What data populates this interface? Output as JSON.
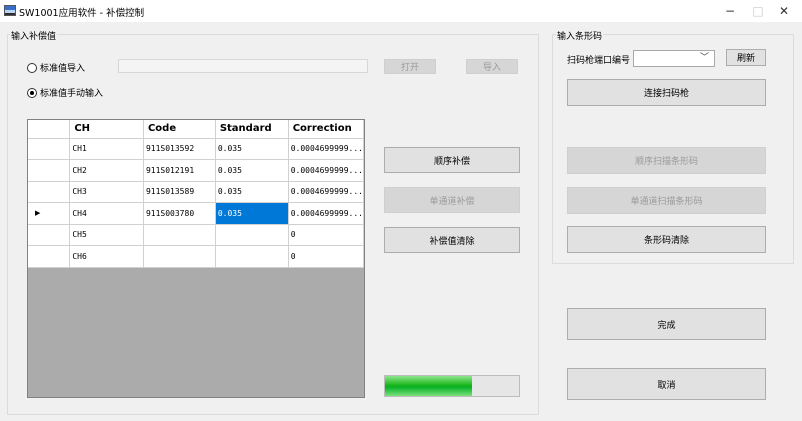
{
  "window": {
    "title": "SW1001应用软件 - 补偿控制",
    "minimize": "−",
    "maximize": "□",
    "close": "✕"
  },
  "input_group": {
    "title": "输入补偿值",
    "radio_import_label": "标准值导入",
    "radio_import_checked": false,
    "radio_manual_label": "标准值手动输入",
    "radio_manual_checked": true,
    "file_path_value": "",
    "open_label": "打开",
    "import_label": "导入"
  },
  "grid": {
    "columns": [
      "CH",
      "Code",
      "Standard",
      "Correction"
    ],
    "current_row_indicator": "▶",
    "rows": [
      {
        "ch": "CH1",
        "code": "911S013592",
        "standard": "0.035",
        "correction": "0.0004699999..."
      },
      {
        "ch": "CH2",
        "code": "911S012191",
        "standard": "0.035",
        "correction": "0.0004699999..."
      },
      {
        "ch": "CH3",
        "code": "911S013589",
        "standard": "0.035",
        "correction": "0.0004699999..."
      },
      {
        "ch": "CH4",
        "code": "911S003780",
        "standard": "0.035",
        "correction": "0.0004699999..."
      },
      {
        "ch": "CH5",
        "code": "",
        "standard": "",
        "correction": "0"
      },
      {
        "ch": "CH6",
        "code": "",
        "standard": "",
        "correction": "0"
      }
    ],
    "current_row": 3,
    "selected_cell_column": "standard"
  },
  "middle_buttons": {
    "sequential_compensation": "顺序补偿",
    "single_channel_compensation": "单通道补偿",
    "clear_compensation": "补偿值清除"
  },
  "progress": {
    "fraction": 0.65,
    "color": "#06b025"
  },
  "barcode_group": {
    "title": "输入条形码",
    "port_label": "扫码枪端口编号",
    "port_value": "",
    "refresh_label": "刷新",
    "connect_label": "连接扫码枪",
    "sequential_scan_label": "顺序扫描条形码",
    "single_scan_label": "单通道扫描条形码",
    "clear_barcode_label": "条形码清除"
  },
  "bottom_buttons": {
    "finish_label": "完成",
    "cancel_label": "取消"
  }
}
